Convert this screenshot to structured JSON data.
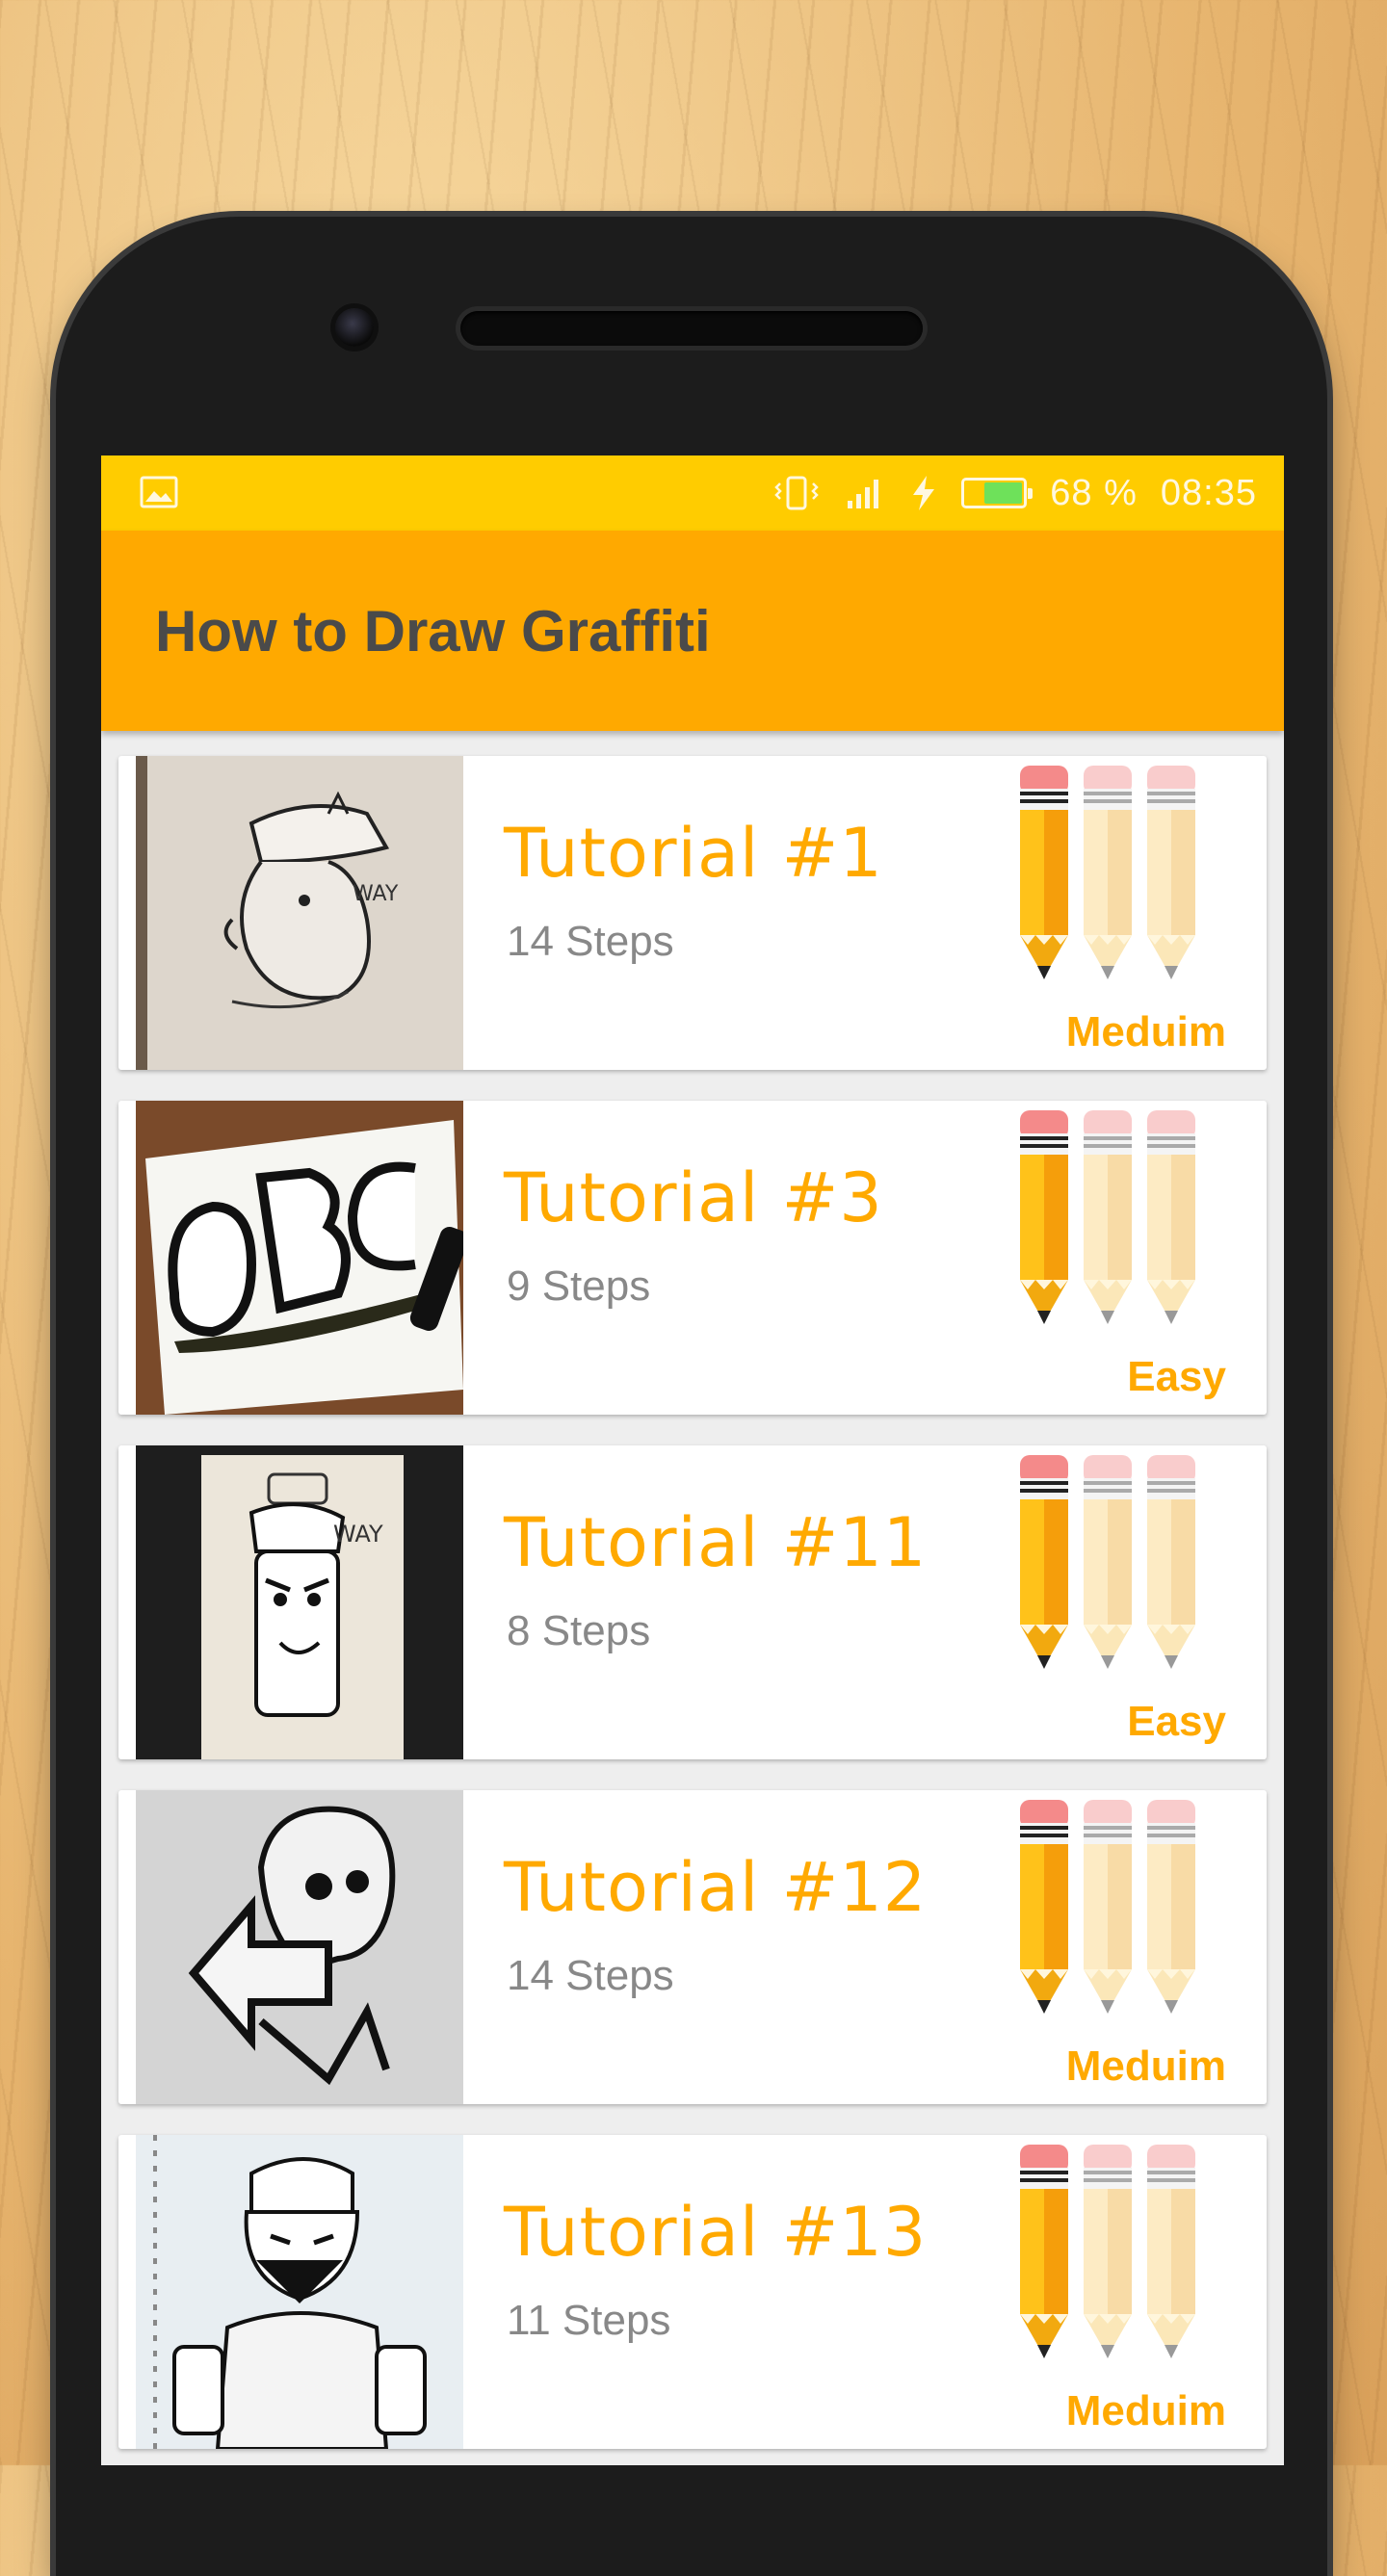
{
  "status_bar": {
    "battery_percent": "68 %",
    "time": "08:35",
    "battery_level": 0.68,
    "icons": [
      "image-icon",
      "vibrate-icon",
      "signal-icon",
      "charging-icon",
      "battery-icon"
    ]
  },
  "app_bar": {
    "title": "How to Draw Graffiti"
  },
  "tutorials": [
    {
      "title": "Tutorial #1",
      "steps": "14 Steps",
      "difficulty": "Meduim",
      "thumbnail": "graffiti-character-cap"
    },
    {
      "title": "Tutorial #3",
      "steps": "9 Steps",
      "difficulty": "Easy",
      "thumbnail": "abc-letters"
    },
    {
      "title": "Tutorial #11",
      "steps": "8 Steps",
      "difficulty": "Easy",
      "thumbnail": "spray-can-character"
    },
    {
      "title": "Tutorial #12",
      "steps": "14 Steps",
      "difficulty": "Meduim",
      "thumbnail": "skull-arrow"
    },
    {
      "title": "Tutorial #13",
      "steps": "11 Steps",
      "difficulty": "Meduim",
      "thumbnail": "bandana-character"
    }
  ],
  "colors": {
    "status_bar": "#ffcc00",
    "app_bar": "#ffa900",
    "accent": "#ffa900",
    "title_text": "#4a4a4a",
    "steps_text": "#888888"
  }
}
